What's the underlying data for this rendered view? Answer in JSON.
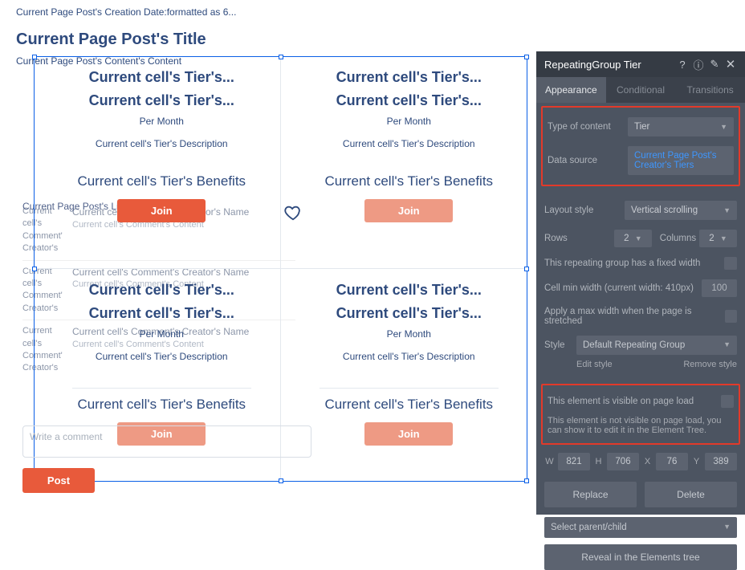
{
  "canvas": {
    "date_text": "Current Page Post's Creation Date:formatted as 6...",
    "title_text": "Current Page Post's Title",
    "content_text": "Current Page Post's Content's Content",
    "likes_text": "Current Page Post's Likes"
  },
  "tier_cell": {
    "line1": "Current cell's Tier's...",
    "line2": "Current cell's Tier's...",
    "per_month": "Per Month",
    "description": "Current cell's Tier's Description",
    "benefits": "Current cell's Tier's Benefits",
    "join_label": "Join"
  },
  "background_comments": {
    "col1_a": "Current cell's Comment' Creator's",
    "creator_name": "Current cell's Comment's Creator's Name",
    "content": "Current cell's Comment's Content"
  },
  "comment_input": {
    "placeholder": "Write a comment",
    "post_label": "Post"
  },
  "panel": {
    "header_title": "RepeatingGroup Tier",
    "tabs": {
      "appearance": "Appearance",
      "conditional": "Conditional",
      "transitions": "Transitions"
    },
    "type_of_content_label": "Type of content",
    "type_of_content_value": "Tier",
    "data_source_label": "Data source",
    "data_source_value": "Current Page Post's Creator's Tiers",
    "layout_style_label": "Layout style",
    "layout_style_value": "Vertical scrolling",
    "rows_label": "Rows",
    "rows_value": "2",
    "columns_label": "Columns",
    "columns_value": "2",
    "fixed_width_label": "This repeating group has a fixed width",
    "cell_min_width_label": "Cell min width (current width: 410px)",
    "cell_min_width_value": "100",
    "apply_max_width_label": "Apply a max width when the page is stretched",
    "style_label": "Style",
    "style_value": "Default Repeating Group",
    "edit_style": "Edit style",
    "remove_style": "Remove style",
    "visible_label": "This element is visible on page load",
    "visible_hint": "This element is not visible on page load, you can show it to edit it in the Element Tree.",
    "coords": {
      "w_label": "W",
      "w": "821",
      "h_label": "H",
      "h": "706",
      "x_label": "X",
      "x": "76",
      "y_label": "Y",
      "y": "389"
    },
    "replace_label": "Replace",
    "delete_label": "Delete",
    "select_parent_label": "Select parent/child",
    "reveal_label": "Reveal in the Elements tree"
  }
}
